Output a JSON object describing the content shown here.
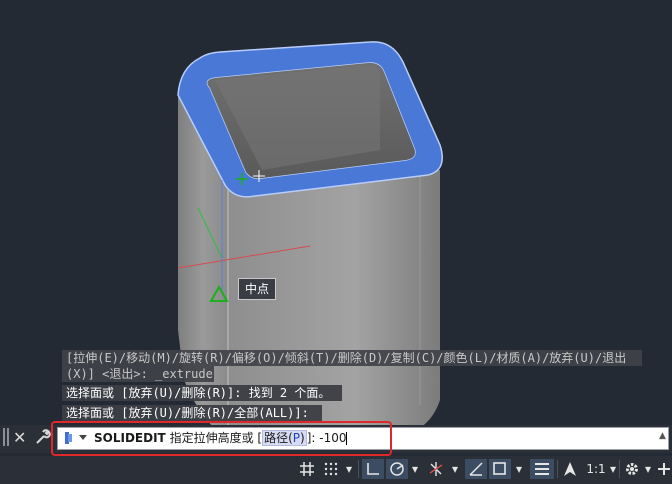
{
  "viewport": {
    "tooltip": "中点",
    "history": [
      "[拉伸(E)/移动(M)/旋转(R)/偏移(O)/倾斜(T)/删除(D)/复制(C)/颜色(L)/材质(A)/放弃(U)/退出",
      "(X)] <退出>: _extrude",
      "选择面或 [放弃(U)/删除(R)]: 找到 2 个面。",
      "选择面或 [放弃(U)/删除(R)/全部(ALL)]:"
    ]
  },
  "command_line": {
    "close_glyph": "✕",
    "command_name": "SOLIDEDIT",
    "prompt": "指定拉伸高度或 [",
    "option_label": "路径(",
    "option_key": "P",
    "option_close": ")",
    "prompt_end": "]: ",
    "input_value": "-100",
    "scroll_glyph": "▲"
  },
  "status_bar": {
    "scale_label": "1:1",
    "dropdown_glyph": "▾"
  },
  "colors": {
    "viewport_bg": "#232a34",
    "solid_fill": "#8b8b8b",
    "selected_face": "#4a78d6",
    "highlight_outline": "#e0282b",
    "osnap_marker": "#19b019"
  }
}
